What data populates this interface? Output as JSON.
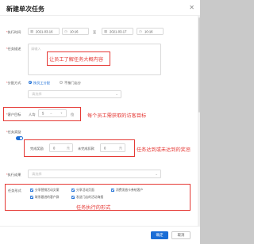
{
  "dialog": {
    "title": "新建单次任务",
    "close_icon": "close-icon"
  },
  "schedule": {
    "label": "执行时间",
    "start_date": "2021-03-16",
    "start_time": "10:16",
    "sep": "至",
    "end_date": "2021-03-17",
    "end_time": "10:16"
  },
  "description": {
    "label": "任务描述",
    "placeholder": "请输入",
    "annotation": "让员工了解任务大概内容"
  },
  "assign": {
    "label": "分配方式",
    "option_by_employee": "按员工分配",
    "option_by_store": "不按门店分",
    "select_placeholder": "请选择"
  },
  "target": {
    "label": "客户目标",
    "prefix": "人均",
    "value": "5",
    "unit": "位",
    "annotation": "每个员工需获取的访客目标"
  },
  "completion": {
    "label": "任务奖励",
    "first_label": "完成奖励",
    "first_value": "0",
    "first_unit": "元",
    "second_label": "未完成扣款",
    "second_value": "0",
    "second_unit": "元",
    "annotation": "任务达到或未达到的奖惩"
  },
  "result": {
    "label": "执行成果",
    "placeholder": "请选择"
  },
  "channels": {
    "label": "任务形式",
    "items": [
      "分享营销活动文案",
      "分享活动页面",
      "消费发放卡券给客户",
      "联系跟进的客户群",
      "发送门店的活动海报"
    ],
    "annotation": "任务执行的形式"
  },
  "footer": {
    "confirm": "确定",
    "cancel": "取消"
  }
}
